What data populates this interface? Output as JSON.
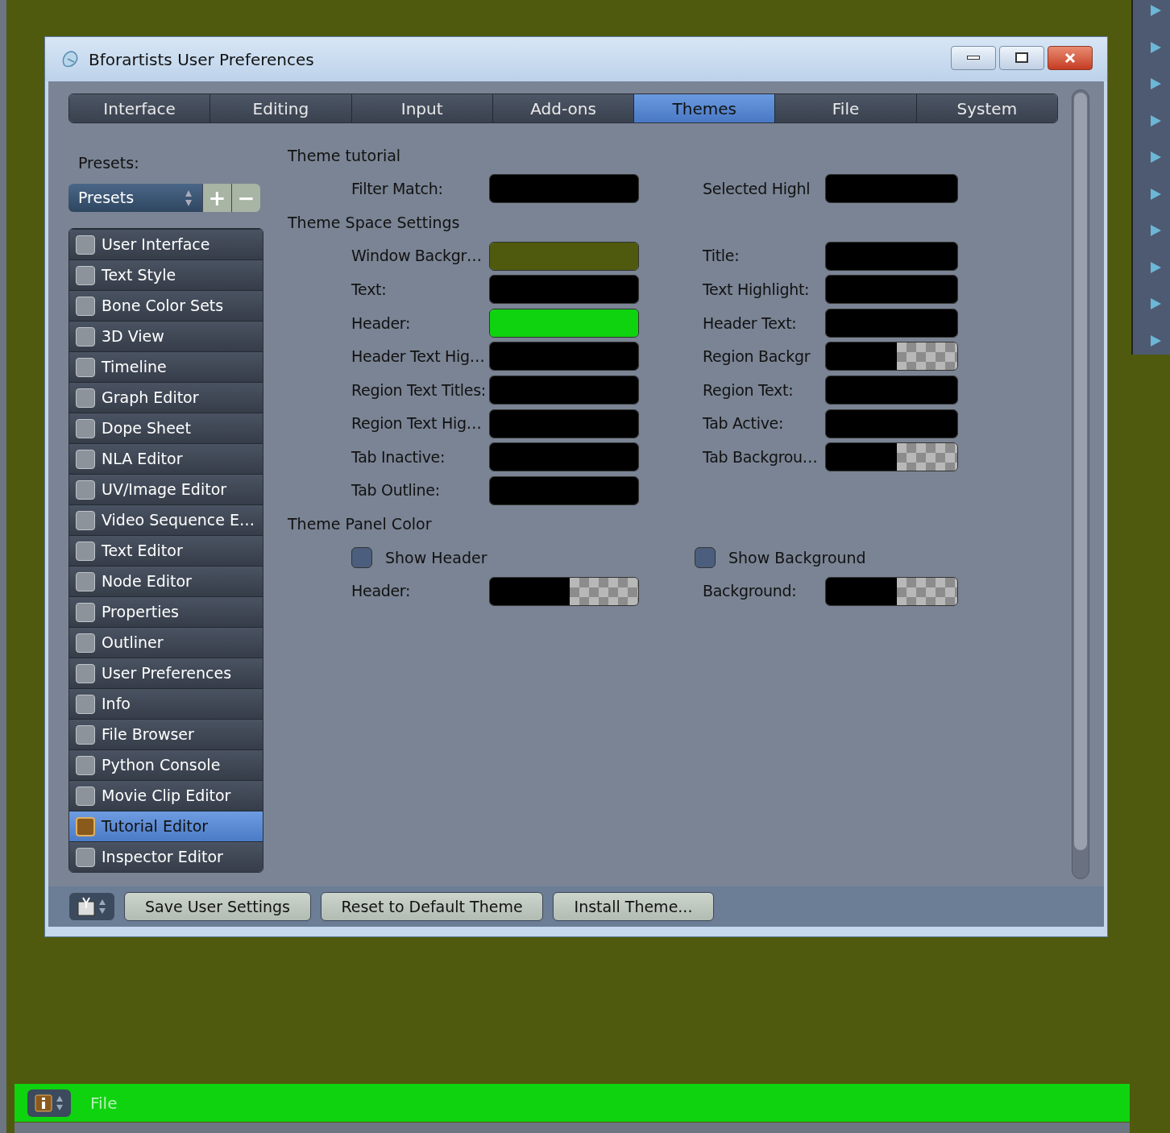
{
  "window": {
    "title": "Bforartists User Preferences"
  },
  "tabs": [
    {
      "label": "Interface",
      "selected": false
    },
    {
      "label": "Editing",
      "selected": false
    },
    {
      "label": "Input",
      "selected": false
    },
    {
      "label": "Add-ons",
      "selected": false
    },
    {
      "label": "Themes",
      "selected": true
    },
    {
      "label": "File",
      "selected": false
    },
    {
      "label": "System",
      "selected": false
    }
  ],
  "presets": {
    "label": "Presets:",
    "menu": "Presets",
    "add": "+",
    "remove": "−"
  },
  "sidebar": {
    "items": [
      {
        "label": "User Interface",
        "selected": false
      },
      {
        "label": "Text Style",
        "selected": false
      },
      {
        "label": "Bone Color Sets",
        "selected": false
      },
      {
        "label": "3D View",
        "selected": false
      },
      {
        "label": "Timeline",
        "selected": false
      },
      {
        "label": "Graph Editor",
        "selected": false
      },
      {
        "label": "Dope Sheet",
        "selected": false
      },
      {
        "label": "NLA Editor",
        "selected": false
      },
      {
        "label": "UV/Image Editor",
        "selected": false
      },
      {
        "label": "Video Sequence E…",
        "selected": false
      },
      {
        "label": "Text Editor",
        "selected": false
      },
      {
        "label": "Node Editor",
        "selected": false
      },
      {
        "label": "Properties",
        "selected": false
      },
      {
        "label": "Outliner",
        "selected": false
      },
      {
        "label": "User Preferences",
        "selected": false
      },
      {
        "label": "Info",
        "selected": false
      },
      {
        "label": "File Browser",
        "selected": false
      },
      {
        "label": "Python Console",
        "selected": false
      },
      {
        "label": "Movie Clip Editor",
        "selected": false
      },
      {
        "label": "Tutorial Editor",
        "selected": true
      },
      {
        "label": "Inspector Editor",
        "selected": false
      }
    ]
  },
  "sections": [
    {
      "title": "Theme tutorial",
      "rows": [
        {
          "cells": [
            {
              "kind": "color",
              "label": "Filter Match:",
              "color": "#000000",
              "alpha": false
            },
            {
              "kind": "color",
              "label": "Selected Highl",
              "color": "#000000",
              "alpha": false
            }
          ]
        }
      ]
    },
    {
      "title": "Theme Space Settings",
      "rows": [
        {
          "cells": [
            {
              "kind": "color",
              "label": "Window Backgr…",
              "color": "#4f5a0e",
              "alpha": false
            },
            {
              "kind": "color",
              "label": "Title:",
              "color": "#000000",
              "alpha": false
            }
          ]
        },
        {
          "cells": [
            {
              "kind": "color",
              "label": "Text:",
              "color": "#000000",
              "alpha": false
            },
            {
              "kind": "color",
              "label": "Text Highlight:",
              "color": "#000000",
              "alpha": false
            }
          ]
        },
        {
          "cells": [
            {
              "kind": "color",
              "label": "Header:",
              "color": "#0fd30f",
              "alpha": false
            },
            {
              "kind": "color",
              "label": "Header Text:",
              "color": "#000000",
              "alpha": false
            }
          ]
        },
        {
          "cells": [
            {
              "kind": "color",
              "label": "Header Text Hig…",
              "color": "#000000",
              "alpha": false
            },
            {
              "kind": "color",
              "label": "Region Backgr",
              "color": "#000000",
              "alpha": true
            }
          ]
        },
        {
          "cells": [
            {
              "kind": "color",
              "label": "Region Text Titles:",
              "color": "#000000",
              "alpha": false
            },
            {
              "kind": "color",
              "label": "Region Text:",
              "color": "#000000",
              "alpha": false
            }
          ]
        },
        {
          "cells": [
            {
              "kind": "color",
              "label": "Region Text Hig…",
              "color": "#000000",
              "alpha": false
            },
            {
              "kind": "color",
              "label": "Tab Active:",
              "color": "#000000",
              "alpha": false
            }
          ]
        },
        {
          "cells": [
            {
              "kind": "color",
              "label": "Tab Inactive:",
              "color": "#000000",
              "alpha": false
            },
            {
              "kind": "color",
              "label": "Tab Backgrou…",
              "color": "#000000",
              "alpha": true
            }
          ]
        },
        {
          "cells": [
            {
              "kind": "color",
              "label": "Tab Outline:",
              "color": "#000000",
              "alpha": false
            }
          ]
        }
      ]
    },
    {
      "title": "Theme Panel Color",
      "rows": [
        {
          "cells": [
            {
              "kind": "checkbox",
              "label": "Show Header",
              "checked": false
            },
            {
              "kind": "checkbox",
              "label": "Show Background",
              "checked": false
            }
          ]
        },
        {
          "cells": [
            {
              "kind": "color",
              "label": "Header:",
              "color": "#000000",
              "alpha": true
            },
            {
              "kind": "color",
              "label": "Background:",
              "color": "#000000",
              "alpha": true
            }
          ]
        }
      ]
    }
  ],
  "footer": {
    "buttons": [
      "Save User Settings",
      "Reset to Default Theme",
      "Install Theme..."
    ]
  },
  "info_header": {
    "menu": "File"
  }
}
